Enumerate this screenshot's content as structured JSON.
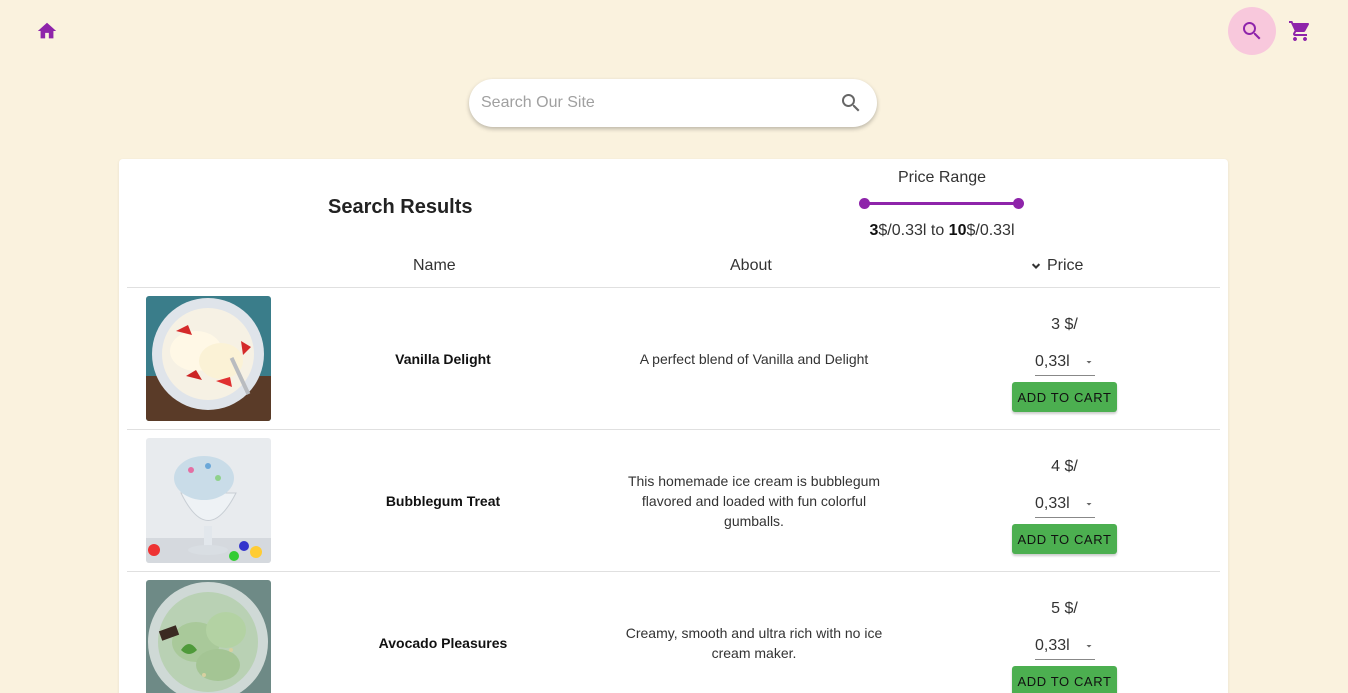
{
  "nav": {
    "home_icon": "home-icon",
    "search_icon": "search-icon",
    "cart_icon": "cart-icon",
    "accent": "#8e24aa"
  },
  "search": {
    "placeholder": "Search Our Site",
    "value": ""
  },
  "results": {
    "title": "Search Results",
    "price_range": {
      "label": "Price Range",
      "min": "3",
      "min_unit": "$/0.33l",
      "to": "to",
      "max": "10",
      "max_unit": "$/0.33l"
    },
    "columns": {
      "name": "Name",
      "about": "About",
      "price": "Price"
    },
    "items": [
      {
        "name": "Vanilla Delight",
        "about": "A perfect blend of Vanilla and Delight",
        "price": "3 $/",
        "size": "0,33l",
        "button": "ADD TO CART"
      },
      {
        "name": "Bubblegum Treat",
        "about": "This homemade ice cream is bubblegum flavored and loaded with fun colorful gumballs.",
        "price": "4 $/",
        "size": "0,33l",
        "button": "ADD TO CART"
      },
      {
        "name": "Avocado Pleasures",
        "about": "Creamy, smooth and ultra rich with no ice cream maker.",
        "price": "5 $/",
        "size": "0,33l",
        "button": "ADD TO CART"
      }
    ]
  },
  "colors": {
    "background": "#faf2de",
    "search_toggle_bg": "#f8c8dc",
    "button_green": "#4caf50"
  }
}
